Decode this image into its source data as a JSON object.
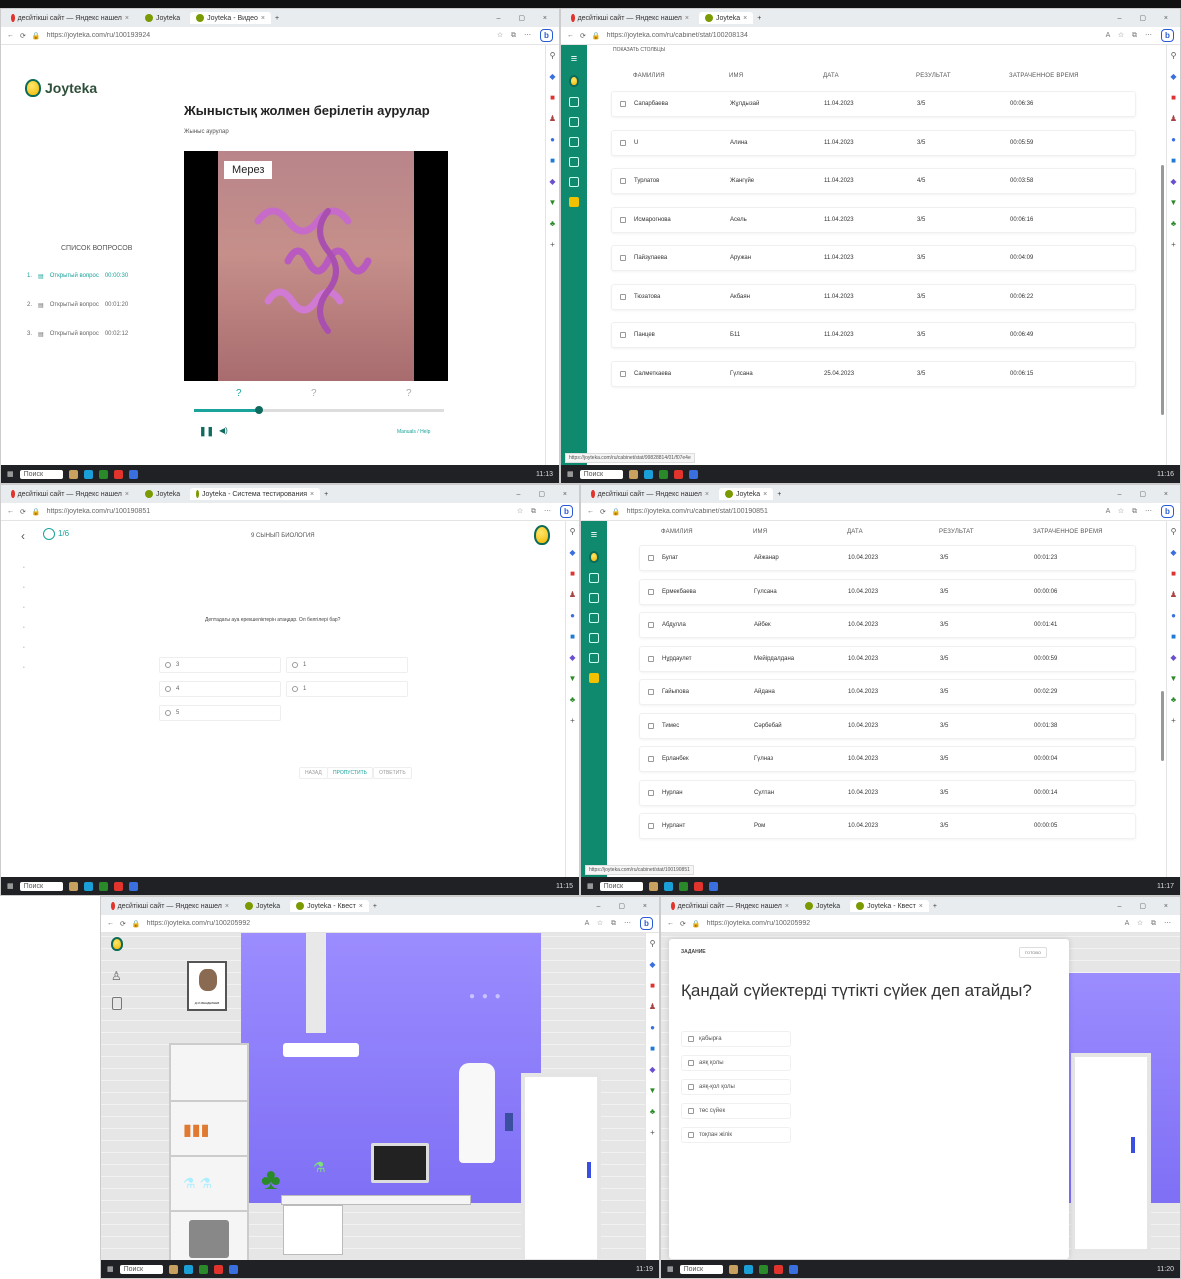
{
  "colors": {
    "joyteka_teal": "#0f8a6f",
    "accent": "#1aa39a",
    "lab_wall": "#e9e9e9",
    "lab_purple": "#9a8cff"
  },
  "browser": {
    "tab_active_label": "Joyteka",
    "tab_yandex": "десйтiкшi сайт — Яндекс нашел",
    "search": "Поиск"
  },
  "panel1": {
    "tabs": [
      "Joyteka",
      "Joyteka - Видео"
    ],
    "url": "https://joyteka.com/ru/100193924",
    "logo": "Joyteka",
    "title": "Жыныстық жолмен берілетін аурулар",
    "subtitle": "Жыныс аурулар",
    "video_label": "Мерез",
    "questions_heading": "СПИСОК ВОПРОСОВ",
    "questions": [
      {
        "num": "1.",
        "label": "Открытый вопрос",
        "time": "00:00:30"
      },
      {
        "num": "2.",
        "label": "Открытый вопрос",
        "time": "00:01:20"
      },
      {
        "num": "3.",
        "label": "Открытый вопрос",
        "time": "00:02:12"
      }
    ],
    "progress": 0.26,
    "report_link": "Manuals / Help",
    "taskbar_time": "11:13"
  },
  "panel2": {
    "tabs": [
      "Joyteka"
    ],
    "url": "https://joyteka.com/ru/cabinet/stat/100208134",
    "show_pages": "ПОКАЗАТЬ СТОЛБЦЫ",
    "headers": [
      "ФАМИЛИЯ",
      "ИМЯ",
      "ДАТА",
      "РЕЗУЛЬТАТ",
      "ЗАТРАЧЕННОЕ ВРЕМЯ"
    ],
    "rows": [
      [
        "Сапарбаева",
        "Жұлдызай",
        "11.04.2023",
        "3/5",
        "00:06:36"
      ],
      [
        "U",
        "Алина",
        "11.04.2023",
        "3/5",
        "00:05:59"
      ],
      [
        "Турлатов",
        "Жангүйе",
        "11.04.2023",
        "4/5",
        "00:03:58"
      ],
      [
        "Исмарогнова",
        "Асель",
        "11.04.2023",
        "3/5",
        "00:06:16"
      ],
      [
        "Пайзулаева",
        "Аружан",
        "11.04.2023",
        "3/5",
        "00:04:09"
      ],
      [
        "Тюзатова",
        "Акбаян",
        "11.04.2023",
        "3/5",
        "00:06:22"
      ],
      [
        "Панцев",
        "Б11",
        "11.04.2023",
        "3/5",
        "00:06:49"
      ],
      [
        "Салметкаева",
        "Гүлсана",
        "25.04.2023",
        "3/5",
        "00:06:15"
      ]
    ],
    "status_url": "https://joyteka.com/ru/cabinet/stat/99828814/01/f07e4e",
    "taskbar_time": "11:16"
  },
  "panel3": {
    "tabs": [
      "Joyteka",
      "Joyteka - Система тестирования"
    ],
    "url": "https://joyteka.com/ru/100190851",
    "counter": "1/6",
    "header": "9 СЫНЫП БИОЛОГИЯ",
    "question": "Дептадагы ауа ерекшеліктерін атаңдар. Ол белгілері бар?",
    "options": [
      "3",
      "1",
      "4",
      "1",
      "5"
    ],
    "buttons": [
      "НАЗАД",
      "ПРОПУСТИТЬ",
      "ОТВЕТИТЬ"
    ],
    "taskbar_time": "11:15"
  },
  "panel4": {
    "tabs": [
      "Joyteka"
    ],
    "url": "https://joyteka.com/ru/cabinet/stat/100190851",
    "headers": [
      "ФАМИЛИЯ",
      "ИМЯ",
      "ДАТА",
      "РЕЗУЛЬТАТ",
      "ЗАТРАЧЕННОЕ ВРЕМЯ"
    ],
    "rows": [
      [
        "Булат",
        "Айжанар",
        "10.04.2023",
        "3/5",
        "00:01:23"
      ],
      [
        "Ермекбаева",
        "Гүлсана",
        "10.04.2023",
        "3/5",
        "00:00:06"
      ],
      [
        "Абдулла",
        "Айбек",
        "10.04.2023",
        "3/5",
        "00:01:41"
      ],
      [
        "Нұрдаулет",
        "Мейірдалдана",
        "10.04.2023",
        "3/5",
        "00:00:59"
      ],
      [
        "Гайыпова",
        "Айдана",
        "10.04.2023",
        "3/5",
        "00:02:29"
      ],
      [
        "Тимес",
        "Сәрбебай",
        "10.04.2023",
        "3/5",
        "00:01:38"
      ],
      [
        "Ерланбек",
        "Гүлназ",
        "10.04.2023",
        "3/5",
        "00:00:04"
      ],
      [
        "Нурлан",
        "Султан",
        "10.04.2023",
        "3/5",
        "00:00:14"
      ],
      [
        "Нурлант",
        "Ром",
        "10.04.2023",
        "3/5",
        "00:00:05"
      ]
    ],
    "status_url": "https://joyteka.com/ru/cabinet/stat/100190851",
    "taskbar_time": "11:17"
  },
  "panel5": {
    "tabs": [
      "Joyteka",
      "Joyteka - Квест"
    ],
    "url": "https://joyteka.com/ru/100205992",
    "portrait_caption": "Д.И.МЕНДЕЛЕЕВ",
    "taskbar_time": "11:19"
  },
  "panel6": {
    "tabs": [
      "Joyteka",
      "Joyteka - Квест"
    ],
    "url": "https://joyteka.com/ru/100205992",
    "task_label": "ЗАДАНИЕ",
    "close_label": "ГОТОВО",
    "question": "Қандай сүйектерді түтікті сүйек деп атайды?",
    "answers": [
      "қабырға",
      "аяқ қолы",
      "аяқ-қол қолы",
      "төс сүйек",
      "тоқпан жілік"
    ],
    "taskbar_time": "11:20"
  }
}
